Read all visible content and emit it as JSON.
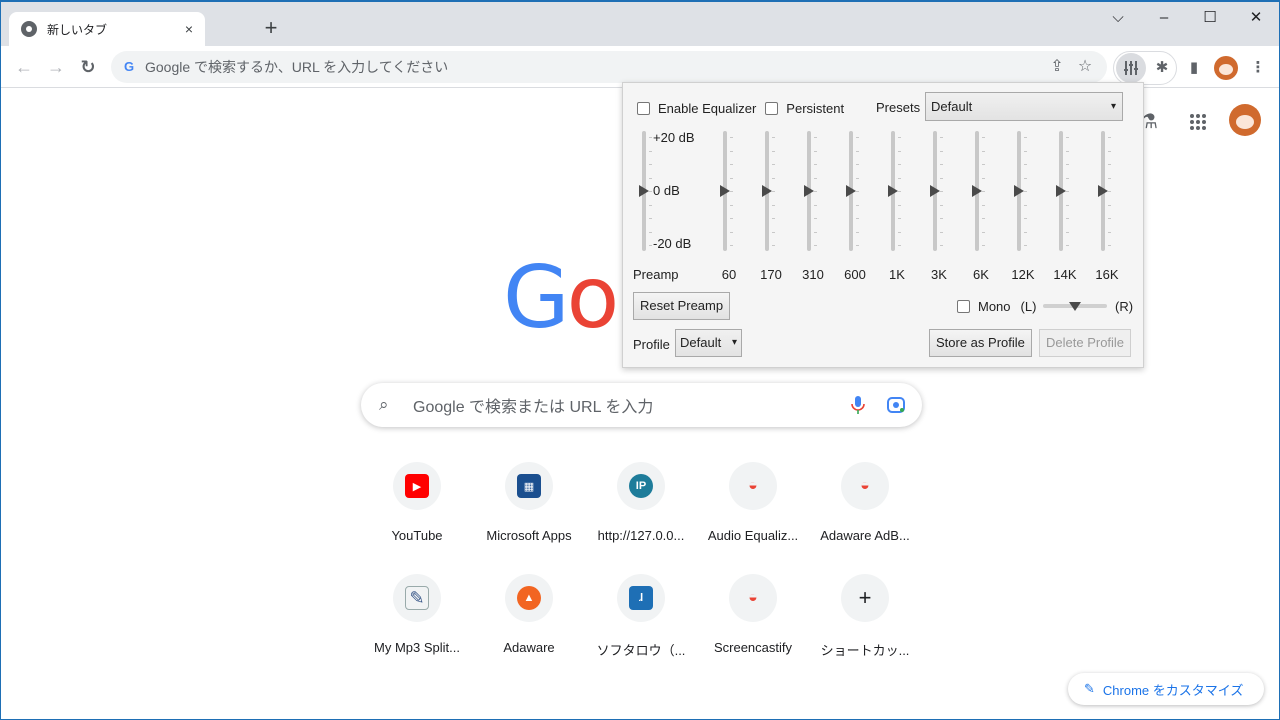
{
  "browser": {
    "tab_title": "新しいタブ",
    "tab_close": "×",
    "new_tab": "+",
    "window_controls": {
      "tab_search": "⌵",
      "minimize": "–",
      "maximize": "☐",
      "close": "✕"
    },
    "nav": {
      "back": "←",
      "forward": "→",
      "reload": "↻"
    },
    "omnibox_placeholder": "Google で検索するか、URL を入力してください",
    "omnibox_g": "G",
    "share_icon": "⇪",
    "bookmark_icon": "☆",
    "extensions_icon": "✱",
    "sidepanel_icon": "▮",
    "menu_icon": "⋮"
  },
  "ntp": {
    "labs_icon": "⚗",
    "apps_icon": "⋮⋮⋮",
    "logo_visible": "Go",
    "search_placeholder": "Google で検索または URL を入力",
    "search_icon": "⌕",
    "mic_icon": "🎤",
    "lens_icon": "◉",
    "shortcuts": [
      {
        "label": "YouTube",
        "icon": "youtube-icon",
        "glyph": "▶",
        "color": "#ff0000"
      },
      {
        "label": "Microsoft Apps",
        "icon": "microsoft-store-icon",
        "glyph": "▦",
        "color": "#1b4f8f"
      },
      {
        "label": "http://127.0.0...",
        "icon": "ip-icon",
        "glyph": "IP",
        "color": "#1e7c9a"
      },
      {
        "label": "Audio Equaliz...",
        "icon": "chrome-webstore-icon",
        "glyph": "◒",
        "color": "#ea4335"
      },
      {
        "label": "Adaware AdB...",
        "icon": "chrome-webstore-icon",
        "glyph": "◒",
        "color": "#ea4335"
      },
      {
        "label": "My Mp3 Split...",
        "icon": "mp3-splitter-icon",
        "glyph": "✎",
        "color": "#3c5a8a"
      },
      {
        "label": "Adaware",
        "icon": "adaware-icon",
        "glyph": "▲",
        "color": "#f26522"
      },
      {
        "label": "ソフタロウ（...",
        "icon": "softarou-icon",
        "glyph": "ɺ",
        "color": "#1e6fb5"
      },
      {
        "label": "Screencastify",
        "icon": "chrome-webstore-icon",
        "glyph": "◒",
        "color": "#ea4335"
      },
      {
        "label": "ショートカッ...",
        "icon": "add-shortcut-icon",
        "glyph": "+",
        "color": "#202124"
      }
    ],
    "customize_label": "Chrome をカスタマイズ",
    "customize_icon": "✎"
  },
  "equalizer": {
    "enable_label": "Enable Equalizer",
    "enable_checked": false,
    "persistent_label": "Persistent",
    "persistent_checked": false,
    "presets_label": "Presets",
    "presets_value": "Default",
    "db_labels": {
      "top": "+20 dB",
      "mid": "0 dB",
      "bottom": "-20 dB"
    },
    "range_db": [
      -20,
      20
    ],
    "preamp_label": "Preamp",
    "preamp_db": 0,
    "bands": [
      {
        "label": "60",
        "db": 0
      },
      {
        "label": "170",
        "db": 0
      },
      {
        "label": "310",
        "db": 0
      },
      {
        "label": "600",
        "db": 0
      },
      {
        "label": "1K",
        "db": 0
      },
      {
        "label": "3K",
        "db": 0
      },
      {
        "label": "6K",
        "db": 0
      },
      {
        "label": "12K",
        "db": 0
      },
      {
        "label": "14K",
        "db": 0
      },
      {
        "label": "16K",
        "db": 0
      }
    ],
    "reset_preamp_label": "Reset Preamp",
    "mono_label": "Mono",
    "mono_checked": false,
    "balance_left": "(L)",
    "balance_right": "(R)",
    "balance_value": 0.5,
    "profile_label": "Profile",
    "profile_value": "Default",
    "store_profile_label": "Store as Profile",
    "delete_profile_label": "Delete Profile",
    "select_arrow": "▾"
  }
}
